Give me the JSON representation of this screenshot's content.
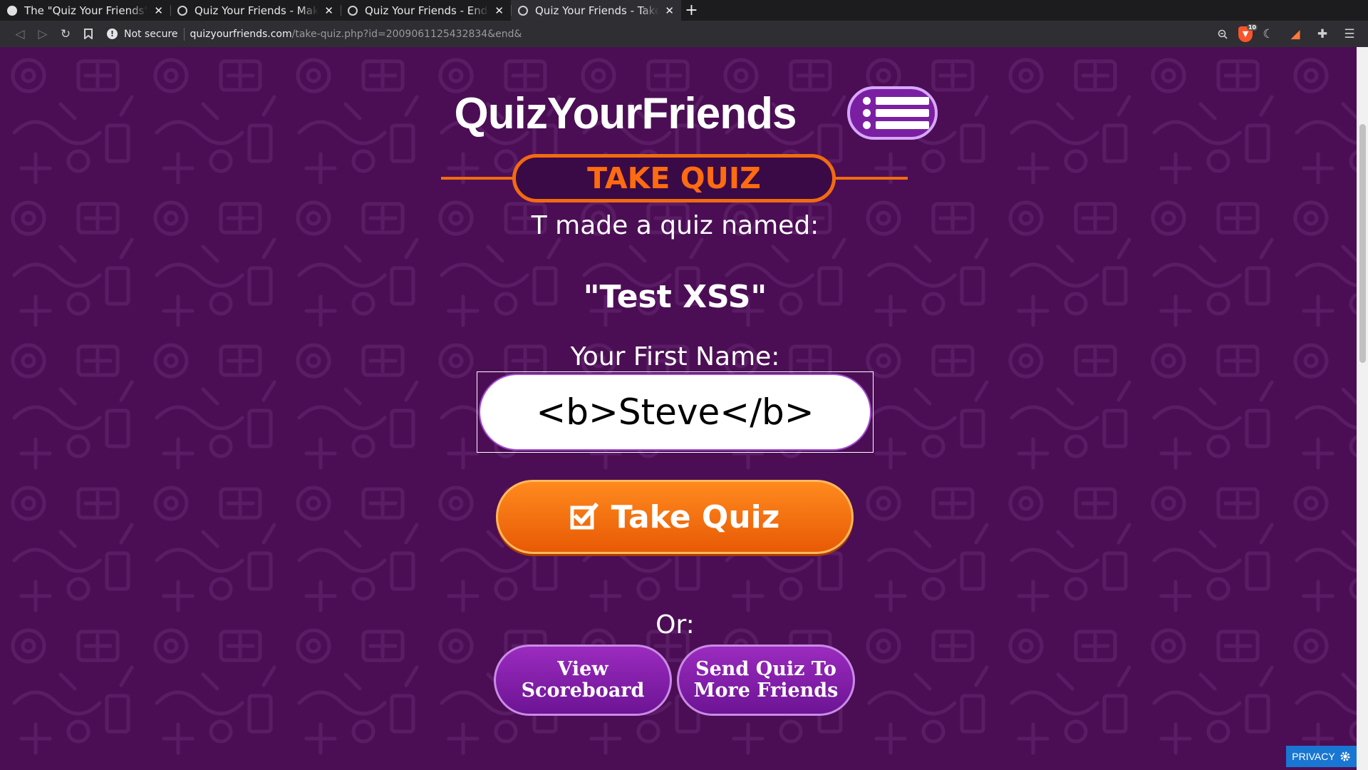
{
  "browser": {
    "tabs": [
      {
        "title": "The \"Quiz Your Friends\" XSS",
        "active": false
      },
      {
        "title": "Quiz Your Friends - Make a Quiz",
        "active": false
      },
      {
        "title": "Quiz Your Friends - End of Quiz",
        "active": false
      },
      {
        "title": "Quiz Your Friends - Take Your Quiz",
        "active": true
      }
    ],
    "new_tab": "+",
    "security_label": "Not secure",
    "url_host": "quizyourfriends.com",
    "url_path": "/take-quiz.php?id=2009061125432834&end&",
    "shield_count": "10"
  },
  "site": {
    "logo": "QuizYourFriends",
    "banner": "TAKE QUIZ"
  },
  "quiz": {
    "made_by": "T made a quiz named:",
    "name": "\"Test XSS\"",
    "first_name_label": "Your First Name:",
    "first_name_value": "<b>Steve</b>",
    "take_quiz_label": "Take Quiz",
    "or_label": "Or:",
    "view_scoreboard": "View Scoreboard",
    "send_quiz": "Send Quiz To More Friends"
  },
  "privacy": {
    "label": "PRIVACY"
  },
  "colors": {
    "background": "#4b0e54",
    "accent_orange": "#f26a10",
    "purple_button": "#7b1fa2",
    "privacy_blue": "#1976d2"
  }
}
